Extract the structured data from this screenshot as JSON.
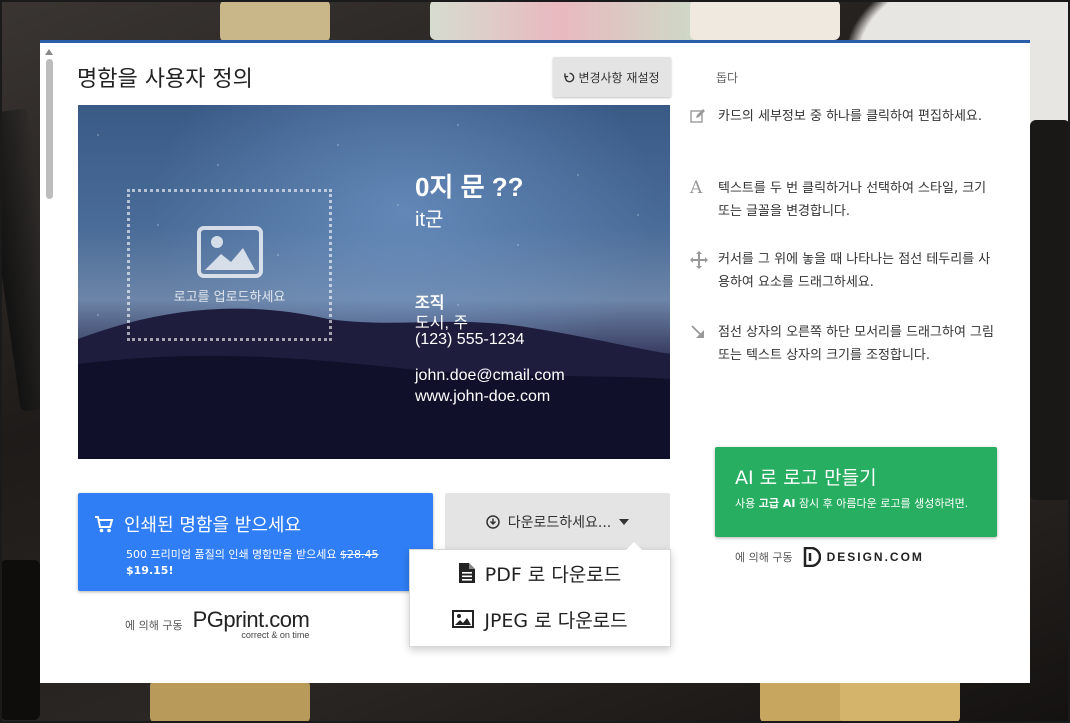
{
  "modal": {
    "title": "명함을 사용자 정의",
    "reset_label": "변경사항 재설정"
  },
  "card": {
    "logo_placeholder": "로고를 업로드하세요",
    "name": "0지 문 ??",
    "job_title": "it군",
    "organization": "조직",
    "city": "도시, 주",
    "phone": "(123) 555-1234",
    "email": "john.doe@cmail.com",
    "website": "www.john-doe.com"
  },
  "print": {
    "label": "인쇄된 명함을 받으세요",
    "sub": "500 프리미엄 품질의 인쇄 명함만을 받으세요",
    "old_price": "$28.45",
    "new_price": "$19.15!",
    "powered_by": "에 의해 구동",
    "brand": "PGprint.com",
    "brand_tagline": "correct & on time"
  },
  "download": {
    "label": "다운로드하세요...",
    "options": [
      "PDF 로 다운로드",
      "JPEG 로 다운로드"
    ]
  },
  "help": {
    "title": "돕다",
    "items": [
      "카드의 세부정보 중 하나를 클릭하여 편집하세요.",
      "텍스트를 두 번 클릭하거나 선택하여 스타일, 크기 또는 글꼴을 변경합니다.",
      "커서를 그 위에 놓을 때 나타나는 점선 테두리를 사용하여 요소를 드래그하세요.",
      "점선 상자의 오른쪽 하단 모서리를 드래그하여 그림 또는 텍스트 상자의 크기를 조정합니다."
    ]
  },
  "ai": {
    "label": "AI 로 로고 만들기",
    "sub_prefix": "사용",
    "sub_bold": "고급 AI",
    "sub_rest": "잠시 후 아름다운 로고를 생성하려면.",
    "powered_by": "에 의해 구동",
    "brand": "DESIGN.COM"
  },
  "colors": {
    "print_blue": "#2f7ef5",
    "ai_green": "#27ae60",
    "top_border": "#2a5ea8"
  }
}
